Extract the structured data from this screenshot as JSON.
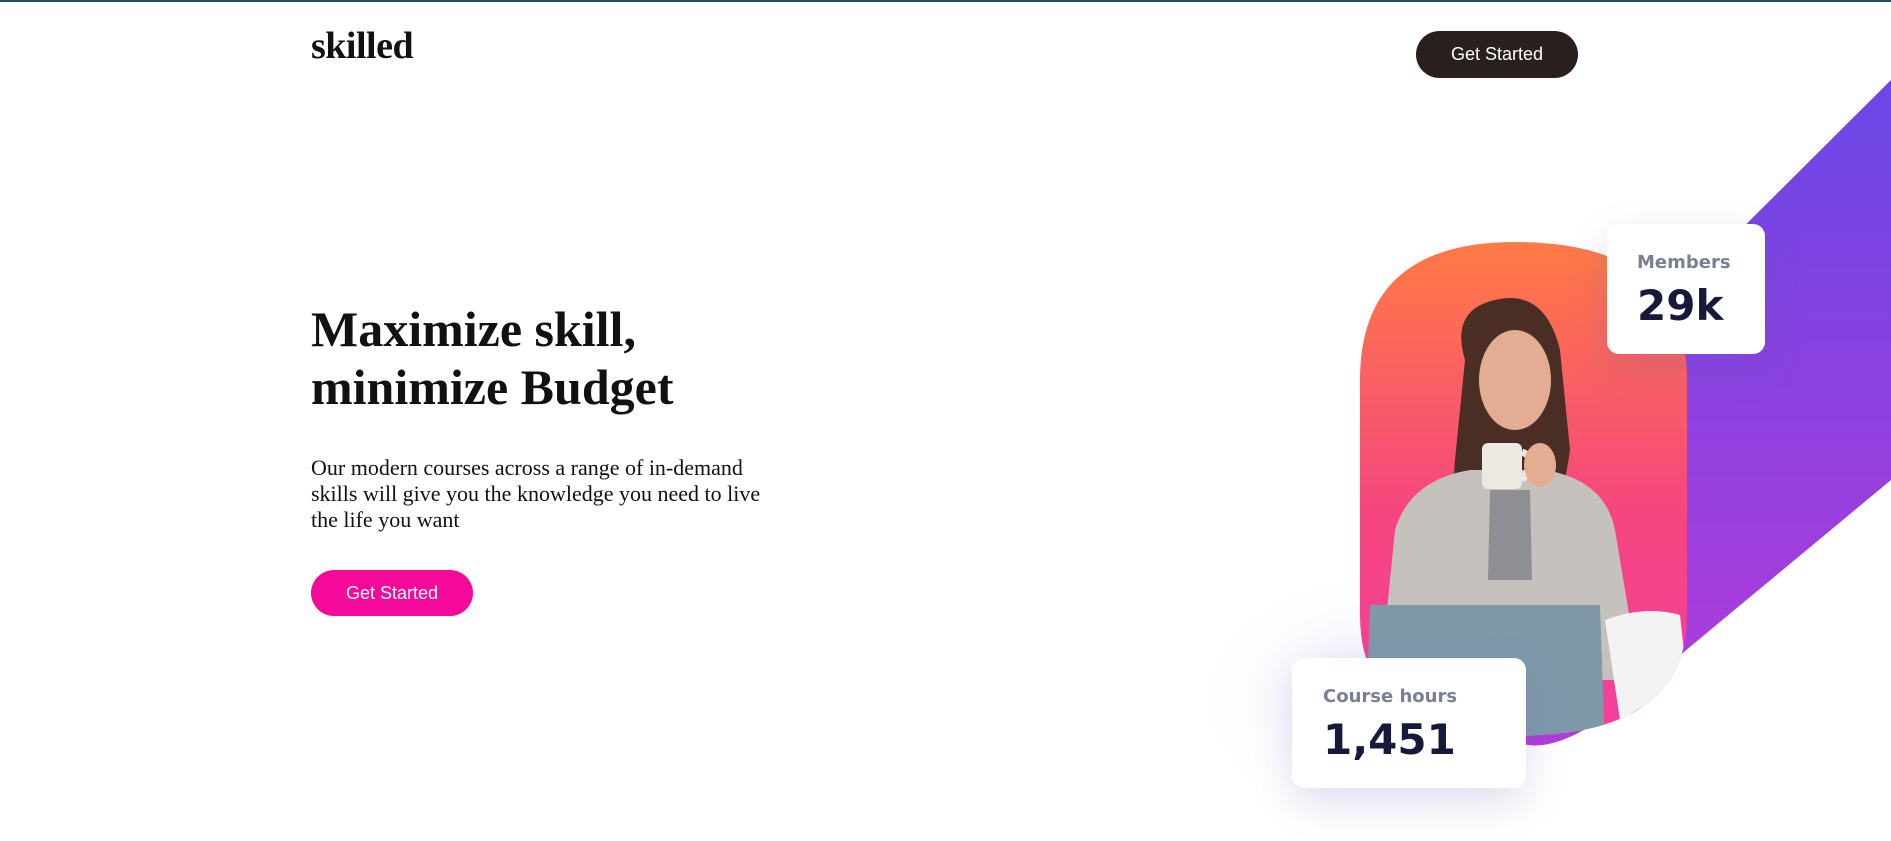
{
  "header": {
    "logo": "skilled",
    "cta_label": "Get Started"
  },
  "hero": {
    "headline_lines": [
      "Maximize skill,",
      "minimize Budget"
    ],
    "subtext_lines": [
      "Our modern courses across a range of in-demand",
      "skills will give you the knowledge you need to live",
      "the life you want"
    ],
    "cta_label": "Get Started"
  },
  "stats": {
    "members": {
      "label": "Members",
      "value": "29k"
    },
    "course_hours": {
      "label": "Course hours",
      "value": "1,451"
    }
  },
  "colors": {
    "nav_button": "#2a1f1f",
    "hero_button": "#f5099b",
    "ribbon_start": "#6a47e6",
    "ribbon_end": "#b33bd9",
    "arch_top": "#ff7a45",
    "arch_bottom": "#f5409b",
    "stat_value": "#16193a"
  },
  "hero_image": {
    "icon": "woman-drinking-coffee-photo"
  }
}
